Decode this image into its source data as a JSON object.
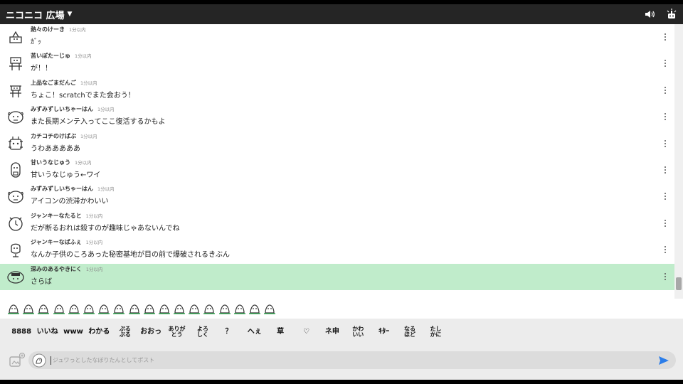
{
  "header": {
    "title": "ニコニコ 広場",
    "caret": "▼"
  },
  "messages": [
    {
      "name": "熱々のけーき",
      "time": "1分以内",
      "text": "ｶﾞｯ",
      "avatar": "character-cake-icon"
    },
    {
      "name": "苦いぽたーじゅ",
      "time": "1分以内",
      "text": "が！！",
      "avatar": "character-potage-icon"
    },
    {
      "name": "上品なごまだんご",
      "time": "1分以内",
      "text": "ちょこ！scratchでまた会おう！",
      "avatar": "character-dango-icon"
    },
    {
      "name": "みずみずしいちゃーはん",
      "time": "1分以内",
      "text": "また長期メンテ入ってここ復活するかもよ",
      "avatar": "character-chahan-icon"
    },
    {
      "name": "カチコチのけばぶ",
      "time": "1分以内",
      "text": "うわあああああ",
      "avatar": "character-kebab-icon"
    },
    {
      "name": "甘いうなじゅう",
      "time": "1分以内",
      "text": "甘いうなじゅう←ワイ",
      "avatar": "character-unaju-icon"
    },
    {
      "name": "みずみずしいちゃーはん",
      "time": "1分以内",
      "text": "アイコンの渋滞かわいい",
      "avatar": "character-chahan-icon"
    },
    {
      "name": "ジャンキーなたると",
      "time": "1分以内",
      "text": "だが断るおれは殺すのが趣味じゃあないんでね",
      "avatar": "character-clock-icon"
    },
    {
      "name": "ジャンキーなぱふぇ",
      "time": "1分以内",
      "text": "なんか子供のころあった秘密基地が目の前で爆破されるきぶん",
      "avatar": "character-parfait-icon"
    },
    {
      "name": "深みのあるやきにく",
      "time": "1分以内",
      "text": "さらば",
      "avatar": "character-yakiniku-icon"
    }
  ],
  "reactions": [
    "8888",
    "いいね",
    "www",
    "わかる",
    "ぷる\nぷる",
    "おおっ",
    "ありが\nとう",
    "よろ\nしく",
    "？",
    "へぇ",
    "草",
    "♡",
    "ネ申",
    "かわ\nいい",
    "ｷﾀｰ",
    "なる\nほど",
    "たし\nかに"
  ],
  "composer": {
    "placeholder": "ジュワっとしたなぼりたんとしてポスト"
  },
  "colors": {
    "header_bg": "#252525",
    "highlight": "#c0eccb",
    "send": "#2b7de9"
  }
}
